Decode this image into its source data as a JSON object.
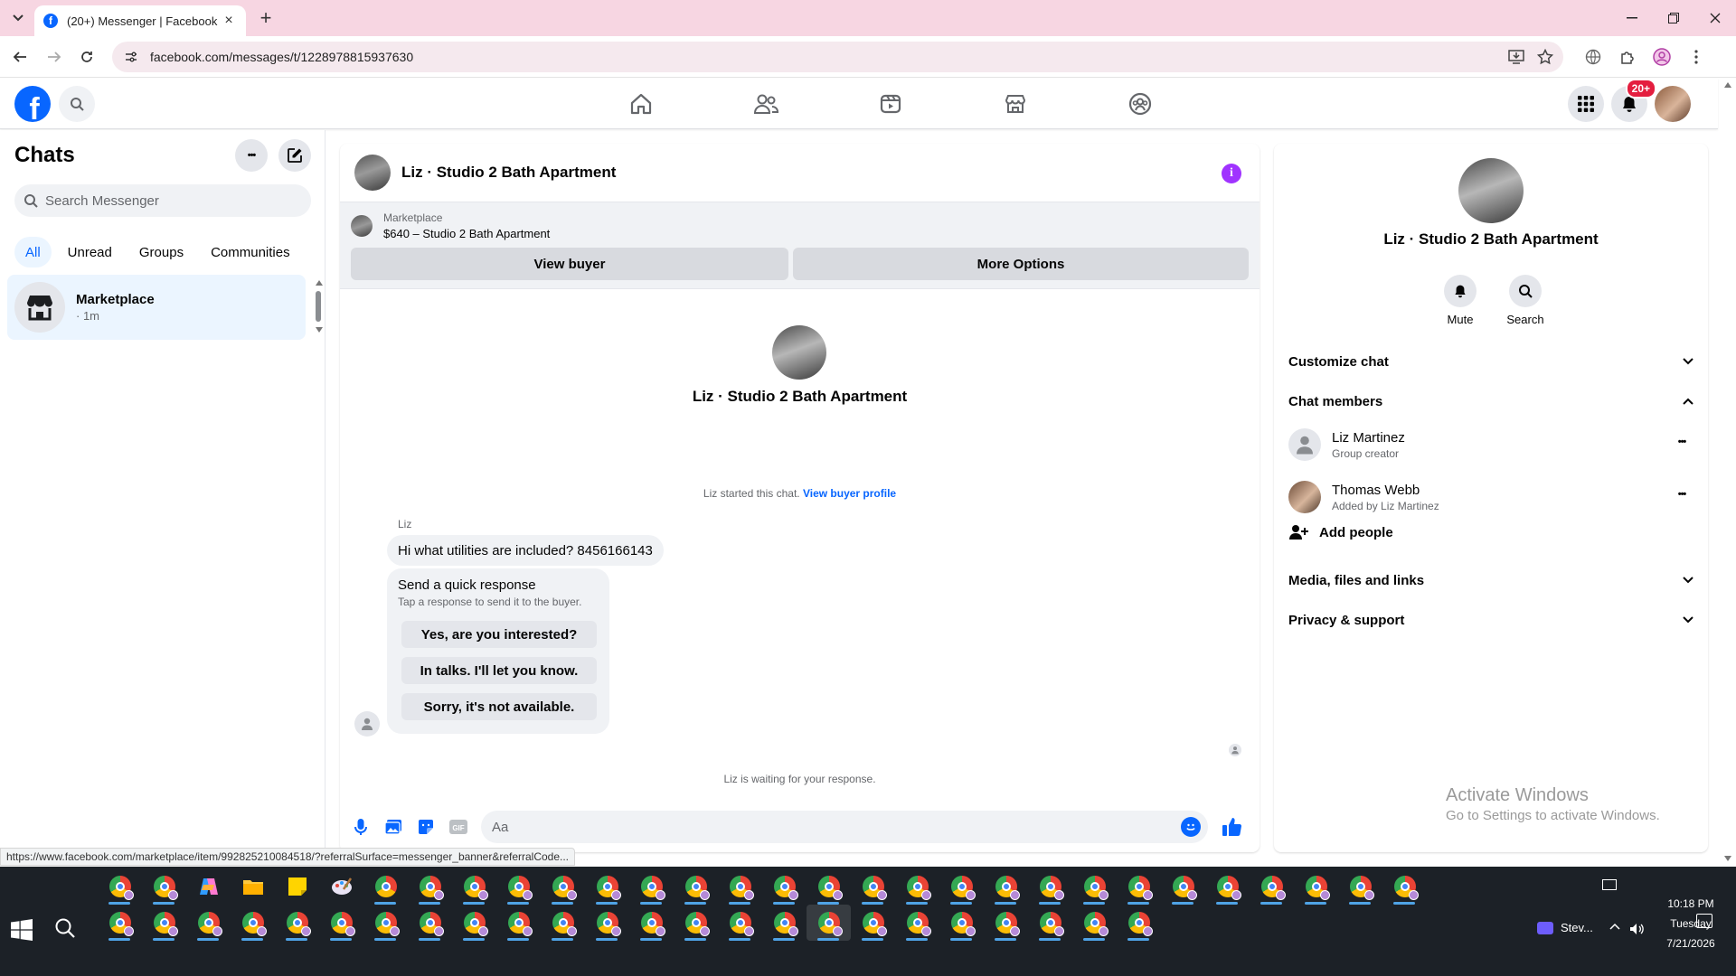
{
  "browser": {
    "tab_title": "(20+) Messenger | Facebook",
    "new_tab_symbol": "+",
    "close_symbol": "×",
    "url": "facebook.com/messages/t/1228978815937630",
    "status_url": "https://www.facebook.com/marketplace/item/992825210084518/?referralSurface=messenger_banner&referralCode..."
  },
  "fb_header": {
    "notification_badge": "20+"
  },
  "chats": {
    "title": "Chats",
    "more_symbol": "•••",
    "search_placeholder": "Search Messenger",
    "filters": [
      "All",
      "Unread",
      "Groups",
      "Communities"
    ],
    "active_filter": "All",
    "items": [
      {
        "name": "Marketplace",
        "time": "· 1m"
      }
    ]
  },
  "conversation": {
    "title": "Liz · Studio 2 Bath Apartment",
    "info_symbol": "i",
    "marketplace_label": "Marketplace",
    "listing": "$640 – Studio 2 Bath Apartment",
    "view_buyer": "View buyer",
    "more_options": "More Options",
    "thread_name": "Liz · Studio 2 Bath Apartment",
    "started_note": "Liz started this chat.",
    "view_buyer_profile": "View buyer profile",
    "sender": "Liz",
    "message": "Hi what utilities are included? 8456166143",
    "quick_title": "Send a quick response",
    "quick_sub": "Tap a response to send it to the buyer.",
    "quick_replies": [
      "Yes, are you interested?",
      "In talks. I'll let you know.",
      "Sorry, it's not available."
    ],
    "waiting_note": "Liz is waiting for your response.",
    "input_placeholder": "Aa"
  },
  "info_panel": {
    "name": "Liz · Studio 2 Bath Apartment",
    "actions": [
      "Mute",
      "Search"
    ],
    "customize_chat": "Customize chat",
    "chat_members": "Chat members",
    "members": [
      {
        "name": "Liz Martinez",
        "sub": "Group creator"
      },
      {
        "name": "Thomas Webb",
        "sub": "Added by Liz Martinez"
      }
    ],
    "member_more_symbol": "•••",
    "add_people": "Add people",
    "media": "Media, files and links",
    "privacy": "Privacy & support"
  },
  "windows": {
    "activate_title": "Activate Windows",
    "activate_sub": "Go to Settings to activate Windows.",
    "time": "10:18 PM",
    "day": "Tuesday",
    "date": "7/21/2026",
    "tray_app": "Stev..."
  },
  "colors": {
    "fb_blue": "#0866ff",
    "selected_chat_bg": "#ebf5ff",
    "info_purple": "#a033ff",
    "badge_red": "#e41e3f",
    "tab_strip": "#f7d6e2",
    "taskbar": "#1c2127"
  }
}
